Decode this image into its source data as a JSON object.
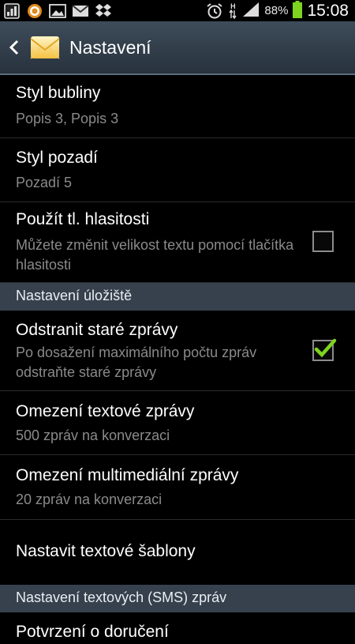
{
  "status_bar": {
    "battery_percent": "88%",
    "time": "15:08",
    "network": "H",
    "icons": [
      "app-icon",
      "browser-icon",
      "image-icon",
      "gmail-icon",
      "dropbox-icon",
      "alarm-icon",
      "data-arrows-icon",
      "signal-icon",
      "battery-icon"
    ]
  },
  "action_bar": {
    "title": "Nastavení"
  },
  "items": [
    {
      "title": "Styl bubliny",
      "summary": "Popis 3, Popis 3"
    },
    {
      "title": "Styl pozadí",
      "summary": "Pozadí 5"
    },
    {
      "title": "Použít tl. hlasitosti",
      "summary": "Můžete změnit velikost textu pomocí tlačítka hlasitosti",
      "checked": false
    },
    {
      "section": "Nastavení úložiště"
    },
    {
      "title": "Odstranit staré zprávy",
      "summary": "Po dosažení maximálního počtu zpráv odstraňte staré zprávy",
      "checked": true
    },
    {
      "title": "Omezení textové zprávy",
      "summary": "500 zpráv na konverzaci"
    },
    {
      "title": "Omezení multimediální zprávy",
      "summary": "20 zpráv na konverzaci"
    },
    {
      "title": "Nastavit textové šablony"
    },
    {
      "section": "Nastavení textových (SMS) zpráv"
    },
    {
      "title": "Potvrzení o doručení"
    }
  ],
  "colors": {
    "checkmark": "#7ed321",
    "section_bg": "#36414d",
    "battery": "#7ed321"
  }
}
